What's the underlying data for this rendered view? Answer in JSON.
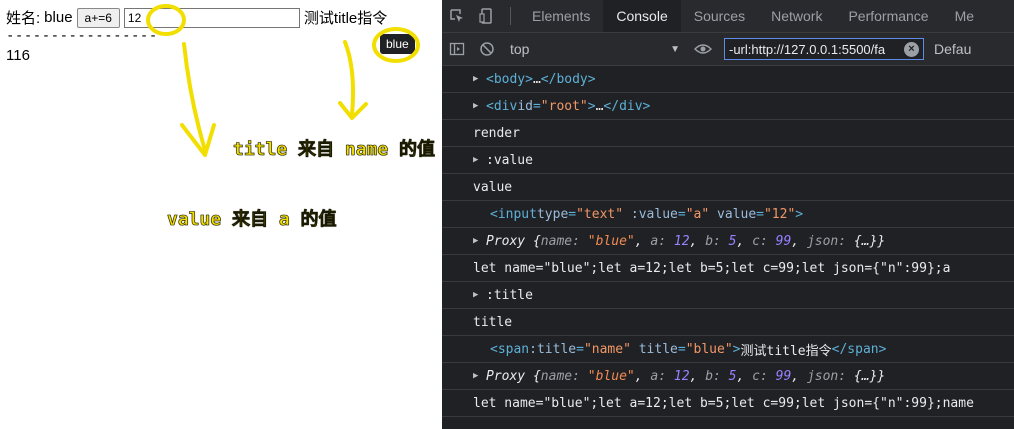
{
  "page": {
    "label": "姓名:",
    "name_value": "blue",
    "button_label": "a+=6",
    "input_value": "12",
    "title_text": "测试title指令",
    "dashes": "-----------------",
    "number": "116",
    "tooltip": "blue"
  },
  "annotations": {
    "title_note": "title 来自 name 的值",
    "value_note": "value 来自 a 的值",
    "color": "#f2df00"
  },
  "devtools": {
    "tabs": [
      "Elements",
      "Console",
      "Sources",
      "Network",
      "Performance",
      "Me"
    ],
    "active_tab": "Console",
    "context": "top",
    "filter_text": "-url:http://127.0.0.1:5500/fa",
    "levels": "Defau",
    "console": {
      "body_tag_open": "<body>",
      "body_ellipsis": "…",
      "body_tag_close": "</body>",
      "div_open_a": "<div ",
      "div_attr": "id",
      "div_eq": "=",
      "div_val": "\"root\"",
      "div_open_b": ">",
      "div_ellipsis": "…",
      "div_close": "</div>",
      "render": "render",
      "value_dir": ":value",
      "value": "value",
      "input_open": "<input ",
      "input_type_attr": "type",
      "input_type_val": "\"text\"",
      "input_bind_attr": ":value",
      "input_bind_val": "\"a\"",
      "input_val_attr": "value",
      "input_val_val": "\"12\"",
      "input_close": ">",
      "proxy1": {
        "prefix": "Proxy {",
        "k_name": "name:",
        "v_name": "\"blue\"",
        "k_a": "a:",
        "v_a": "12",
        "k_b": "b:",
        "v_b": "5",
        "k_c": "c:",
        "v_c": "99",
        "k_json": "json:",
        "v_json": "{…}",
        "suffix": "}"
      },
      "let1": "let name=\"blue\";let a=12;let b=5;let c=99;let json={\"n\":99};a",
      "title_dir": ":title",
      "title": "title",
      "span_open": "<span ",
      "span_bind_attr": ":title",
      "span_bind_val": "\"name\"",
      "span_title_attr": "title",
      "span_title_val": "\"blue\"",
      "span_gt": ">",
      "span_text": "测试title指令",
      "span_close": "</span>",
      "proxy2": {
        "prefix": "Proxy {",
        "k_name": "name:",
        "v_name": "\"blue\"",
        "k_a": "a:",
        "v_a": "12",
        "k_b": "b:",
        "v_b": "5",
        "k_c": "c:",
        "v_c": "99",
        "k_json": "json:",
        "v_json": "{…}",
        "suffix": "}"
      },
      "let2": "let name=\"blue\";let a=12;let b=5;let c=99;let json={\"n\":99};name"
    }
  }
}
